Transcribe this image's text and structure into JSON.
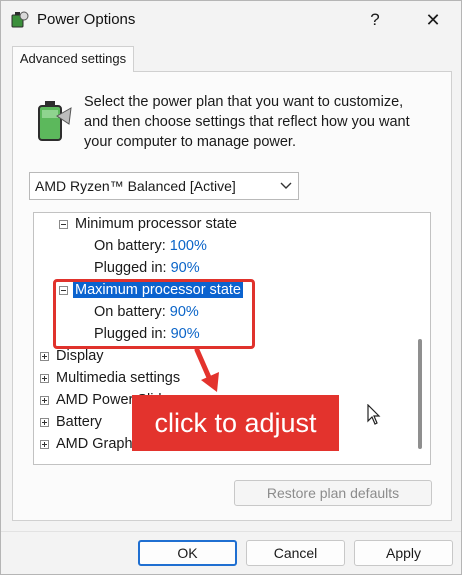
{
  "window": {
    "title": "Power Options",
    "help_label": "?",
    "close_label": "✕"
  },
  "tab": {
    "label": "Advanced settings"
  },
  "description": "Select the power plan that you want to customize, and then choose settings that reflect how you want your computer to manage power.",
  "plan_select": {
    "value": "AMD Ryzen™ Balanced [Active]"
  },
  "tree": {
    "min_state": {
      "label": "Minimum processor state",
      "on_battery_label": "On battery:",
      "on_battery_value": "100%",
      "plugged_in_label": "Plugged in:",
      "plugged_in_value": "90%"
    },
    "max_state": {
      "label": "Maximum processor state",
      "on_battery_label": "On battery:",
      "on_battery_value": "90%",
      "plugged_in_label": "Plugged in:",
      "plugged_in_value": "90%"
    },
    "collapsed_items": [
      "Display",
      "Multimedia settings",
      "AMD Power Slid",
      "Battery",
      "AMD Graph"
    ]
  },
  "callout": {
    "text": "click to adjust"
  },
  "buttons": {
    "restore": "Restore plan defaults",
    "ok": "OK",
    "cancel": "Cancel",
    "apply": "Apply"
  },
  "colors": {
    "accent": "#0b63cf",
    "value_link": "#0a64c8",
    "annotation_red": "#e3332d"
  }
}
